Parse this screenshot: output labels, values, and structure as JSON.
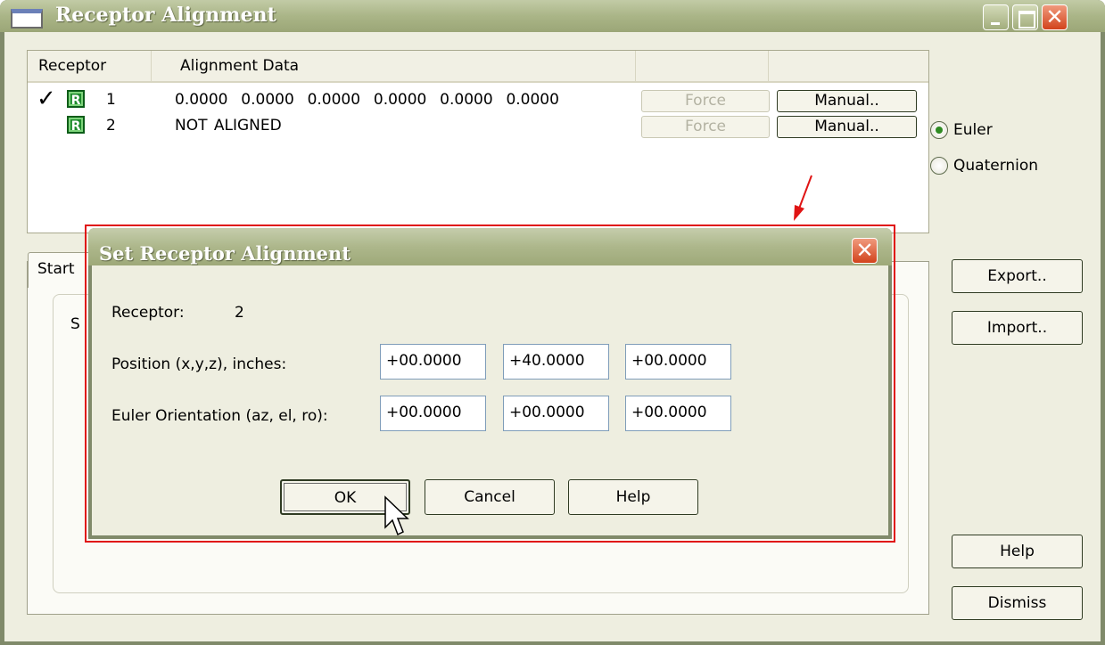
{
  "window": {
    "title": "Receptor Alignment"
  },
  "receptor_list": {
    "columns": [
      "Receptor",
      "Alignment Data",
      "",
      ""
    ],
    "rows": [
      {
        "number": "1",
        "checked": true,
        "receptor_icon": "R",
        "alignment_data": "0.0000  0.0000  0.0000  0.0000  0.0000  0.0000",
        "force_label": "Force",
        "manual_label": "Manual.."
      },
      {
        "number": "2",
        "checked": false,
        "receptor_icon": "R",
        "alignment_data": "NOT ALIGNED",
        "force_label": "Force",
        "manual_label": "Manual.."
      }
    ]
  },
  "orientation_mode": {
    "options": [
      "Euler",
      "Quaternion"
    ],
    "selected": "Euler"
  },
  "tab": {
    "visible_label": "Start",
    "group_label": "S"
  },
  "side_buttons": {
    "export": "Export..",
    "import": "Import..",
    "help": "Help",
    "dismiss": "Dismiss"
  },
  "dialog": {
    "title": "Set Receptor Alignment",
    "receptor_label": "Receptor:",
    "receptor_value": "2",
    "position_label": "Position (x,y,z), inches:",
    "position_values": [
      "+00.0000",
      "+40.0000",
      "+00.0000"
    ],
    "orientation_label": "Euler Orientation (az, el, ro):",
    "orientation_values": [
      "+00.0000",
      "+00.0000",
      "+00.0000"
    ],
    "ok": "OK",
    "cancel": "Cancel",
    "help": "Help"
  },
  "colors": {
    "titlebar": "#aab587",
    "client": "#eeeee0",
    "highlight": "#e01414",
    "receptor_icon": "#1d8a2c"
  }
}
